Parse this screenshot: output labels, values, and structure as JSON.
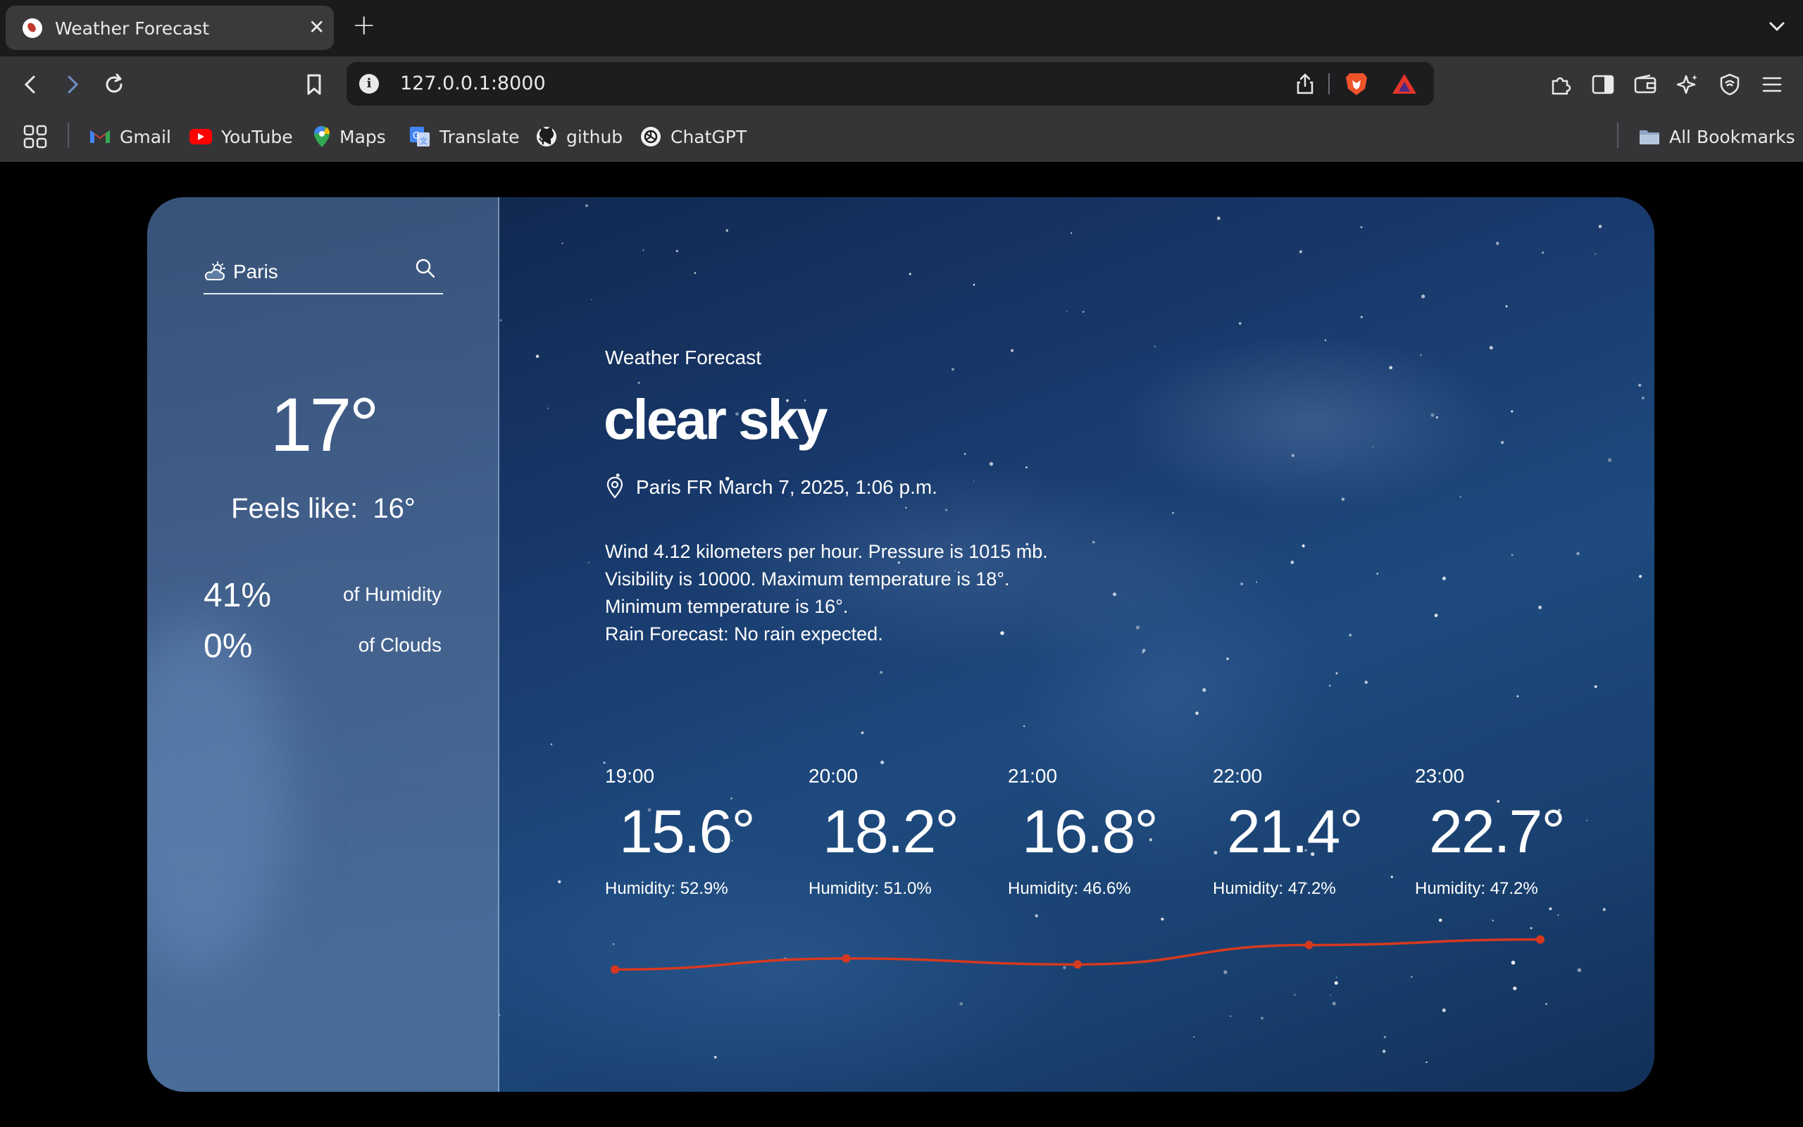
{
  "browser": {
    "tab_title": "Weather Forecast",
    "url": "127.0.0.1:8000",
    "bookmarks": [
      {
        "label": "Gmail",
        "icon": "gmail-icon"
      },
      {
        "label": "YouTube",
        "icon": "youtube-icon"
      },
      {
        "label": "Maps",
        "icon": "maps-icon"
      },
      {
        "label": "Translate",
        "icon": "translate-icon"
      },
      {
        "label": "github",
        "icon": "github-icon"
      },
      {
        "label": "ChatGPT",
        "icon": "chatgpt-icon"
      }
    ],
    "all_bookmarks": "All Bookmarks"
  },
  "search": {
    "value": "Paris"
  },
  "current": {
    "temp": "17°",
    "feels_like_label": "Feels like:",
    "feels_like_value": "16°",
    "humidity_value": "41%",
    "humidity_label": "of Humidity",
    "clouds_value": "0%",
    "clouds_label": "of Clouds"
  },
  "main": {
    "subtitle": "Weather Forecast",
    "condition": "clear sky",
    "location_line": "Paris FR March 7, 2025, 1:06 p.m.",
    "description": [
      "Wind 4.12 kilometers per hour. Pressure is 1015 mb.",
      "Visibility is 10000. Maximum temperature is 18°.",
      "Minimum temperature is 16°.",
      "Rain Forecast: No rain expected."
    ]
  },
  "forecast": [
    {
      "time": "19:00",
      "temp": "15.6°",
      "humidity": "Humidity: 52.9%"
    },
    {
      "time": "20:00",
      "temp": "18.2°",
      "humidity": "Humidity: 51.0%"
    },
    {
      "time": "21:00",
      "temp": "16.8°",
      "humidity": "Humidity: 46.6%"
    },
    {
      "time": "22:00",
      "temp": "21.4°",
      "humidity": "Humidity: 47.2%"
    },
    {
      "time": "23:00",
      "temp": "22.7°",
      "humidity": "Humidity: 47.2%"
    }
  ],
  "chart_data": {
    "type": "line",
    "x": [
      "19:00",
      "20:00",
      "21:00",
      "22:00",
      "23:00"
    ],
    "values": [
      15.6,
      18.2,
      16.8,
      21.4,
      22.7
    ],
    "ylim": [
      5,
      30
    ],
    "grid": false,
    "color": "#d6391f"
  }
}
